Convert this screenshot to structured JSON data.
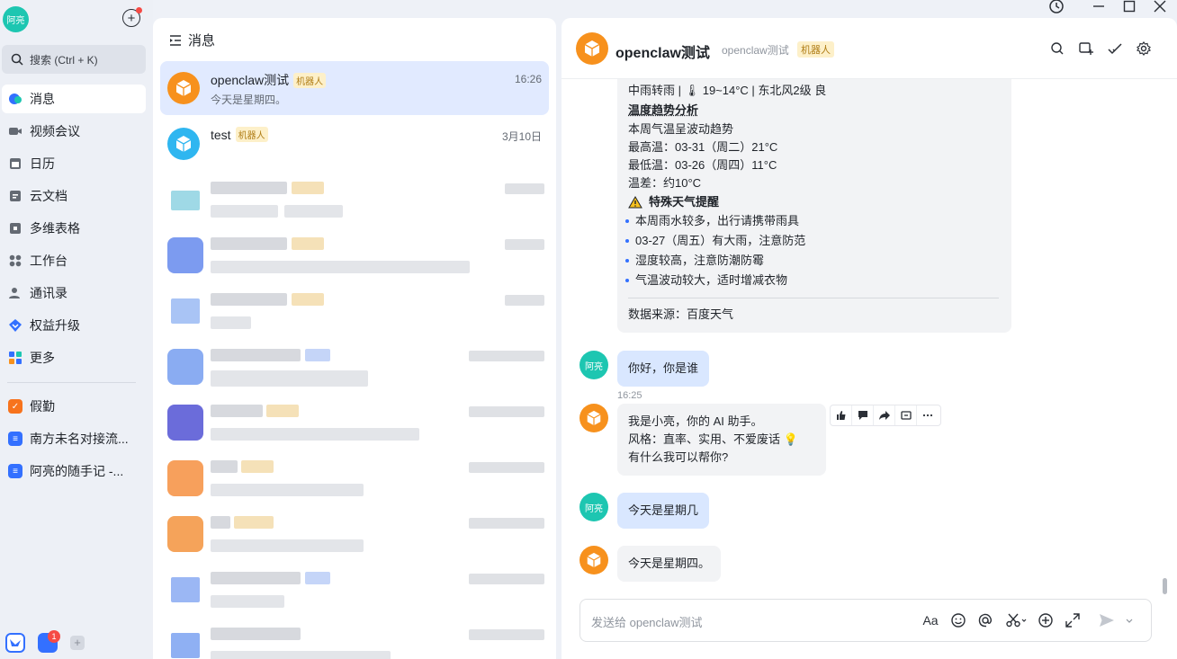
{
  "app": {
    "user_avatar_text": "阿亮",
    "search_placeholder": "搜索 (Ctrl + K)",
    "accent": "#3370ff"
  },
  "nav": {
    "items": [
      {
        "label": "消息",
        "icon": "message-icon"
      },
      {
        "label": "视频会议",
        "icon": "video-icon"
      },
      {
        "label": "日历",
        "icon": "calendar-icon"
      },
      {
        "label": "云文档",
        "icon": "doc-icon"
      },
      {
        "label": "多维表格",
        "icon": "table-icon"
      },
      {
        "label": "工作台",
        "icon": "workspace-icon"
      },
      {
        "label": "通讯录",
        "icon": "contacts-icon"
      },
      {
        "label": "权益升级",
        "icon": "upgrade-icon"
      },
      {
        "label": "更多",
        "icon": "more-apps-icon"
      }
    ],
    "shortcuts": [
      {
        "label": "假勤"
      },
      {
        "label": "南方未名对接流..."
      },
      {
        "label": "阿亮的随手记 -..."
      }
    ],
    "dock_badge": "1"
  },
  "list": {
    "header": "消息",
    "conversations": [
      {
        "name": "openclaw测试",
        "tag": "机器人",
        "time": "16:26",
        "preview": "今天是星期四。"
      },
      {
        "name": "test",
        "tag": "机器人",
        "time": "3月10日",
        "preview": ""
      }
    ]
  },
  "chat": {
    "title": "openclaw测试",
    "subtitle": "openclaw测试",
    "tag": "机器人",
    "weather": {
      "line1": "中雨转雨 | 🌡 19~14°C | 东北风2级 良",
      "trend_title": "温度趋势分析",
      "trend_desc": "本周气温呈波动趋势",
      "max": "最高温：03-31（周二）21°C",
      "min": "最低温：03-26（周四）11°C",
      "diff": "温差：约10°C",
      "alert_title": "特殊天气提醒",
      "alerts": [
        "本周雨水较多，出行请携带雨具",
        "03-27（周五）有大雨，注意防范",
        "湿度较高，注意防潮防霉",
        "气温波动较大，适时增减衣物"
      ],
      "source": "数据来源：百度天气"
    },
    "messages": [
      {
        "from": "user",
        "avatar": "阿亮",
        "text": "你好，你是谁"
      },
      {
        "from": "bot",
        "time": "16:25",
        "lines": [
          "我是小亮，你的 AI 助手。",
          "风格：直率、实用、不爱废话 💡",
          "有什么我可以帮你?"
        ]
      },
      {
        "from": "user",
        "avatar": "阿亮",
        "text": "今天是星期几"
      },
      {
        "from": "bot",
        "text": "今天是星期四。"
      }
    ],
    "input_placeholder": "发送给 openclaw测试"
  }
}
